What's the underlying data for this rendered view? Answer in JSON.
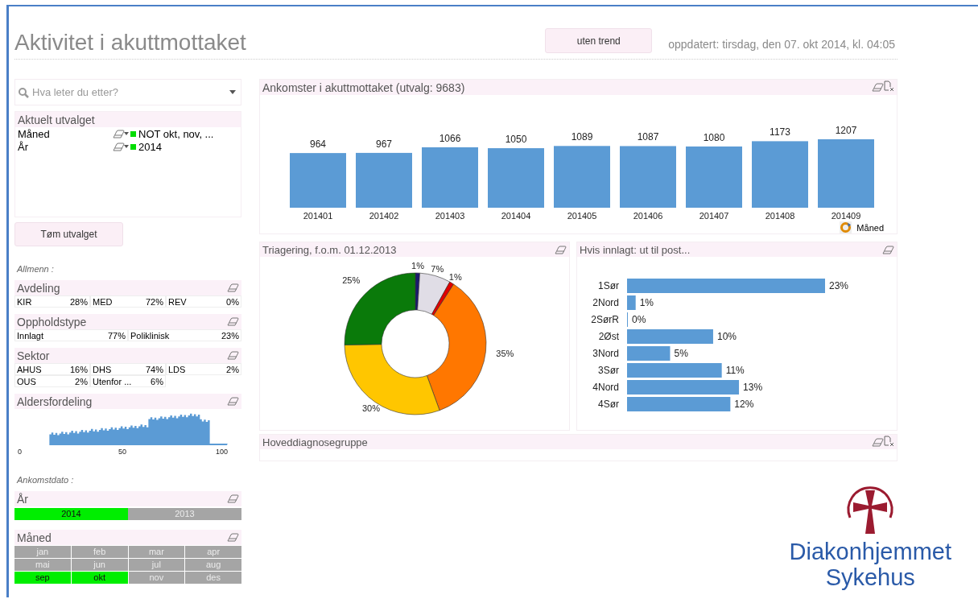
{
  "header": {
    "title": "Aktivitet i akuttmottaket",
    "trend_button": "uten trend",
    "updated": "oppdatert: tirsdag, den 07. okt 2014, kl. 04:05"
  },
  "search": {
    "placeholder": "Hva leter du etter?"
  },
  "current_selections": {
    "title": "Aktuelt utvalget",
    "rows": [
      {
        "field": "Måned",
        "value": "NOT okt, nov, ..."
      },
      {
        "field": "År",
        "value": "2014"
      }
    ]
  },
  "clear_button": "Tøm utvalget",
  "general": {
    "heading": "Allmenn :",
    "lists": [
      {
        "title": "Avdeling",
        "items": [
          {
            "label": "KIR",
            "value": "28%"
          },
          {
            "label": "MED",
            "value": "72%"
          },
          {
            "label": "REV",
            "value": "0%"
          }
        ]
      },
      {
        "title": "Oppholdstype",
        "items": [
          {
            "label": "Innlagt",
            "value": "77%"
          },
          {
            "label": "Poliklinisk",
            "value": "23%"
          }
        ]
      },
      {
        "title": "Sektor",
        "items": [
          {
            "label": "AHUS",
            "value": "16%"
          },
          {
            "label": "DHS",
            "value": "74%"
          },
          {
            "label": "LDS",
            "value": "2%"
          },
          {
            "label": "OUS",
            "value": "2%"
          },
          {
            "label": "Utenfor ...",
            "value": "6%"
          }
        ]
      }
    ]
  },
  "age": {
    "title": "Aldersfordeling",
    "axis_labels": [
      "0",
      "50",
      "100"
    ]
  },
  "arrival": {
    "heading": "Ankomstdato :",
    "year": {
      "title": "År",
      "items": [
        {
          "label": "2014",
          "selected": true
        },
        {
          "label": "2013",
          "selected": false
        }
      ]
    },
    "month": {
      "title": "Måned",
      "items": [
        {
          "label": "jan",
          "selected": false
        },
        {
          "label": "feb",
          "selected": false
        },
        {
          "label": "mar",
          "selected": false
        },
        {
          "label": "apr",
          "selected": false
        },
        {
          "label": "mai",
          "selected": false
        },
        {
          "label": "jun",
          "selected": false
        },
        {
          "label": "jul",
          "selected": false
        },
        {
          "label": "aug",
          "selected": false
        },
        {
          "label": "sep",
          "selected": true
        },
        {
          "label": "okt",
          "selected": true
        },
        {
          "label": "nov",
          "selected": false
        },
        {
          "label": "des",
          "selected": false
        }
      ]
    }
  },
  "arrivals_chart": {
    "title": "Ankomster i akuttmottaket (utvalg: 9683)",
    "dimension": "Måned",
    "chart_data": {
      "type": "bar",
      "categories": [
        "201401",
        "201402",
        "201403",
        "201404",
        "201405",
        "201406",
        "201407",
        "201408",
        "201409"
      ],
      "values": [
        964,
        967,
        1066,
        1050,
        1089,
        1087,
        1080,
        1173,
        1207
      ],
      "value_labels": [
        "964",
        "967",
        "1066",
        "1050",
        "1089",
        "1087",
        "1080",
        "1173",
        "1207"
      ]
    }
  },
  "triage": {
    "title": "Triagering, f.o.m. 01.12.2013",
    "chart_data": {
      "type": "donut",
      "values": [
        1,
        7,
        1,
        35,
        30,
        25
      ],
      "value_labels": [
        "1%",
        "7%",
        "1%",
        "35%",
        "30%",
        "25%"
      ],
      "colors": [
        "#1a1a6e",
        "#e0dde6",
        "#e00000",
        "#ff7700",
        "#ffc600",
        "#0a7a0a"
      ]
    }
  },
  "wards": {
    "title": "Hvis innlagt: ut til post...",
    "chart_data": {
      "type": "bar",
      "orientation": "horizontal",
      "categories": [
        "1Sør",
        "2Nord",
        "2SørR",
        "2Øst",
        "3Nord",
        "3Sør",
        "4Nord",
        "4Sør"
      ],
      "values": [
        23,
        1,
        0,
        10,
        5,
        11,
        13,
        12
      ],
      "value_labels": [
        "23%",
        "1%",
        "0%",
        "10%",
        "5%",
        "11%",
        "13%",
        "12%"
      ]
    }
  },
  "diagnosis": {
    "title": "Hoveddiagnosegruppe"
  },
  "logo": {
    "line1": "Diakonhjemmet",
    "line2": "Sykehus"
  }
}
